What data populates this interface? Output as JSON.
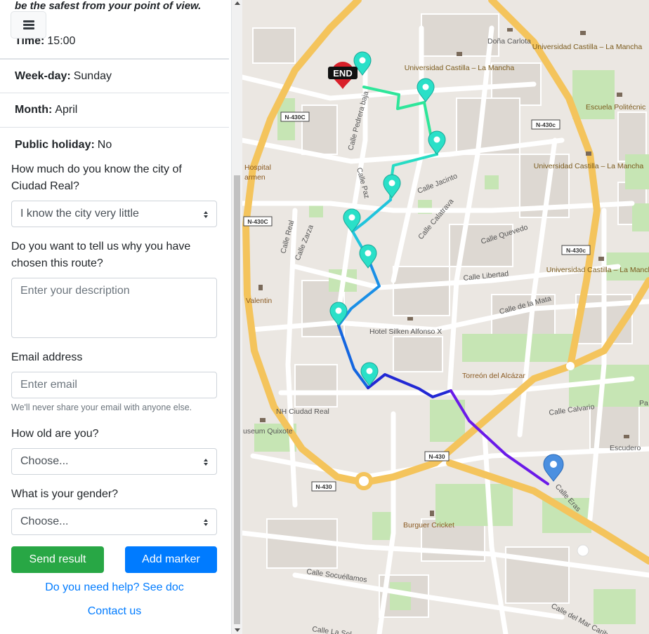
{
  "sidebar": {
    "quote": "be the safest from your point of view.",
    "info": {
      "time_label": "Time:",
      "time_value": "15:00",
      "weekday_label": "Week-day:",
      "weekday_value": "Sunday",
      "month_label": "Month:",
      "month_value": "April",
      "holiday_label": "Public holiday:",
      "holiday_value": "No"
    },
    "form": {
      "knowledge_label": "How much do you know the city of Ciudad Real?",
      "knowledge_value": "I know the city very little",
      "reason_label": "Do you want to tell us why you have chosen this route?",
      "reason_placeholder": "Enter your description",
      "email_label": "Email address",
      "email_placeholder": "Enter email",
      "email_help": "We'll never share your email with anyone else.",
      "age_label": "How old are you?",
      "age_value": "Choose...",
      "gender_label": "What is your gender?",
      "gender_value": "Choose...",
      "send_button": "Send result",
      "add_marker_button": "Add marker",
      "help_link": "Do you need help? See doc",
      "contact_link": "Contact us"
    }
  },
  "map": {
    "end_marker": "END",
    "streets": [
      "Doña Carlota",
      "Calle Pedrera baja",
      "Calle Paz",
      "Calle Jacinto",
      "Calle Calatrava",
      "Calle Quevedo",
      "Calle Real",
      "Calle Zarza",
      "Calle Libertad",
      "Calle de la Mata",
      "Calle Calvario",
      "Calle Socuéllamos",
      "Calle del Mar Caribe",
      "Calle La Sol",
      "Calle Eras"
    ],
    "places": [
      "Universidad Castilla – La Mancha",
      "Escuela Politécnic",
      "Hospital",
      "armen",
      "Valentin",
      "Hotel Silken Alfonso X",
      "Torreón del Alcázar",
      "NH Ciudad Real",
      "useum Quixote",
      "Burguer Cricket",
      "Escudero",
      "Pa"
    ],
    "roads": [
      "N-430C",
      "N-430c",
      "N-430"
    ],
    "route_colors": [
      "#2ee6a0",
      "#26d9d0",
      "#1aa8e8",
      "#1060e0",
      "#2a2ad8",
      "#6a1ae8"
    ],
    "marker_color": "#2ae0d0",
    "end_color": "#d9202a",
    "dest_color": "#4a8fe0"
  }
}
